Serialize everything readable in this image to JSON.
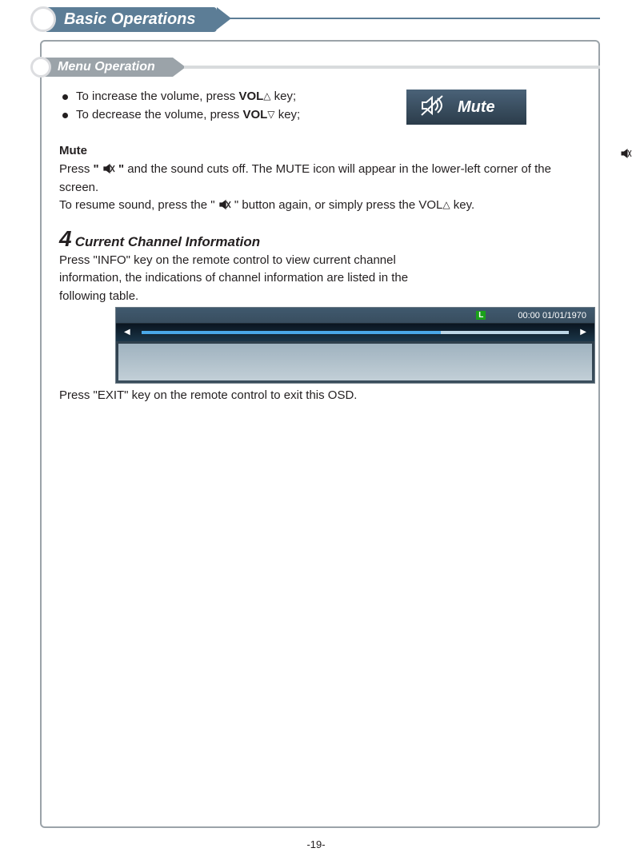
{
  "header": {
    "title": "Basic Operations"
  },
  "subheader": {
    "title": "Menu Operation"
  },
  "volume": {
    "increase_pre": "To increase the volume, press ",
    "increase_key": "VOL",
    "increase_suffix": " key;",
    "decrease_pre": "To decrease the volume, press ",
    "decrease_key": "VOL",
    "decrease_suffix": " key;"
  },
  "muteBox": {
    "label": "Mute"
  },
  "muteSection": {
    "heading": "Mute",
    "line1_pre": "Press ",
    "line1_q1": "\" ",
    "line1_q2": " \"",
    "line1_post": " and the sound cuts off. The MUTE icon will appear in the lower-left corner of the screen.",
    "line2_pre": "To resume sound, press the \" ",
    "line2_mid": " \" button again, or simply press the VOL",
    "line2_post": " key."
  },
  "step": {
    "num": "4",
    "title": "Current Channel Information",
    "desc": "Press \"INFO\" key on the remote control to view current channel information, the indications of channel information are listed in the following table.",
    "exit": "Press \"EXIT\" key on the remote control to exit this OSD."
  },
  "infoPanel": {
    "badge": "L",
    "timestamp": "00:00 01/01/1970"
  },
  "footer": {
    "page": "-19-"
  },
  "glyphs": {
    "triUp": "△",
    "triDown": "▽",
    "arrowL": "◀",
    "arrowR": "▶"
  }
}
